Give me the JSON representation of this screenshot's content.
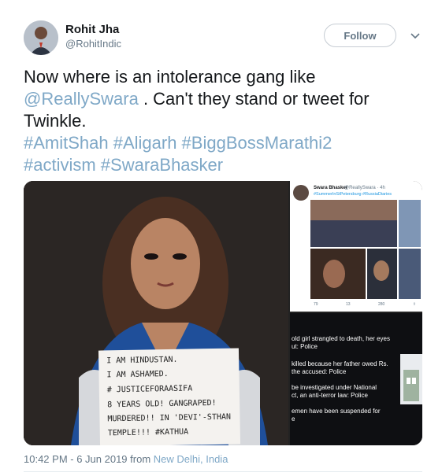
{
  "author": {
    "name": "Rohit Jha",
    "handle": "@RohitIndic"
  },
  "follow_label": "Follow",
  "text": {
    "part1": "Now where is an intolerance gang like ",
    "mention": "@ReallySwara",
    "part2": " . Can't they stand or tweet for Twinkle."
  },
  "hashtags": {
    "line1": "#AmitShah #Aligarh #BiggBossMarathi2",
    "line2": "#activism #SwaraBhasker"
  },
  "media": {
    "sign_lines": [
      "I AM HINDUSTAN.",
      "I AM ASHAMED.",
      "# JUSTICEFORAASIFA",
      "8 YEARS OLD! GANGRAPED!",
      "MURDERED!! IN 'DEVI'-STHAN",
      "TEMPLE!!! #KATHUA"
    ],
    "embedded_tweet": {
      "name": "Swara Bhasker",
      "handle": "@ReallySwara · 4h",
      "tags": "#SummerInStPetersburg #RussiaDiaries",
      "actions": [
        "79",
        "13",
        "280",
        ""
      ]
    },
    "news_lines": [
      "old girl strangled to death, her eyes",
      "ut: Police",
      "killed because her father owed Rs.",
      "the accused: Police",
      "be investigated under National",
      "ct, an anti-terror law: Police",
      "emen have been suspended for",
      "e"
    ]
  },
  "footer": {
    "time": "10:42 PM - 6 Jun 2019 from ",
    "location": "New Delhi, India"
  }
}
